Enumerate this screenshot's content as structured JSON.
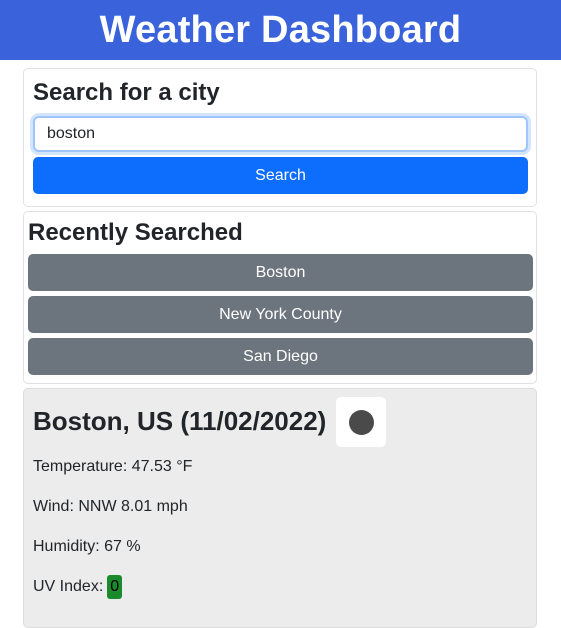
{
  "header": {
    "title": "Weather Dashboard"
  },
  "search": {
    "heading": "Search for a city",
    "value": "boston",
    "button_label": "Search"
  },
  "recent": {
    "heading": "Recently Searched",
    "items": [
      "Boston",
      "New York County",
      "San Diego"
    ]
  },
  "current": {
    "title": "Boston, US (11/02/2022)",
    "icon": "weather-condition-icon",
    "temperature": "Temperature: 47.53 °F",
    "wind": "Wind: NNW 8.01 mph",
    "humidity": "Humidity: 67 %",
    "uv_label": "UV Index:",
    "uv_value": "0",
    "uv_color": "#1b8a2a"
  },
  "colors": {
    "header_bg": "#3a63db",
    "primary": "#0d6efd",
    "secondary": "#6c757d"
  }
}
